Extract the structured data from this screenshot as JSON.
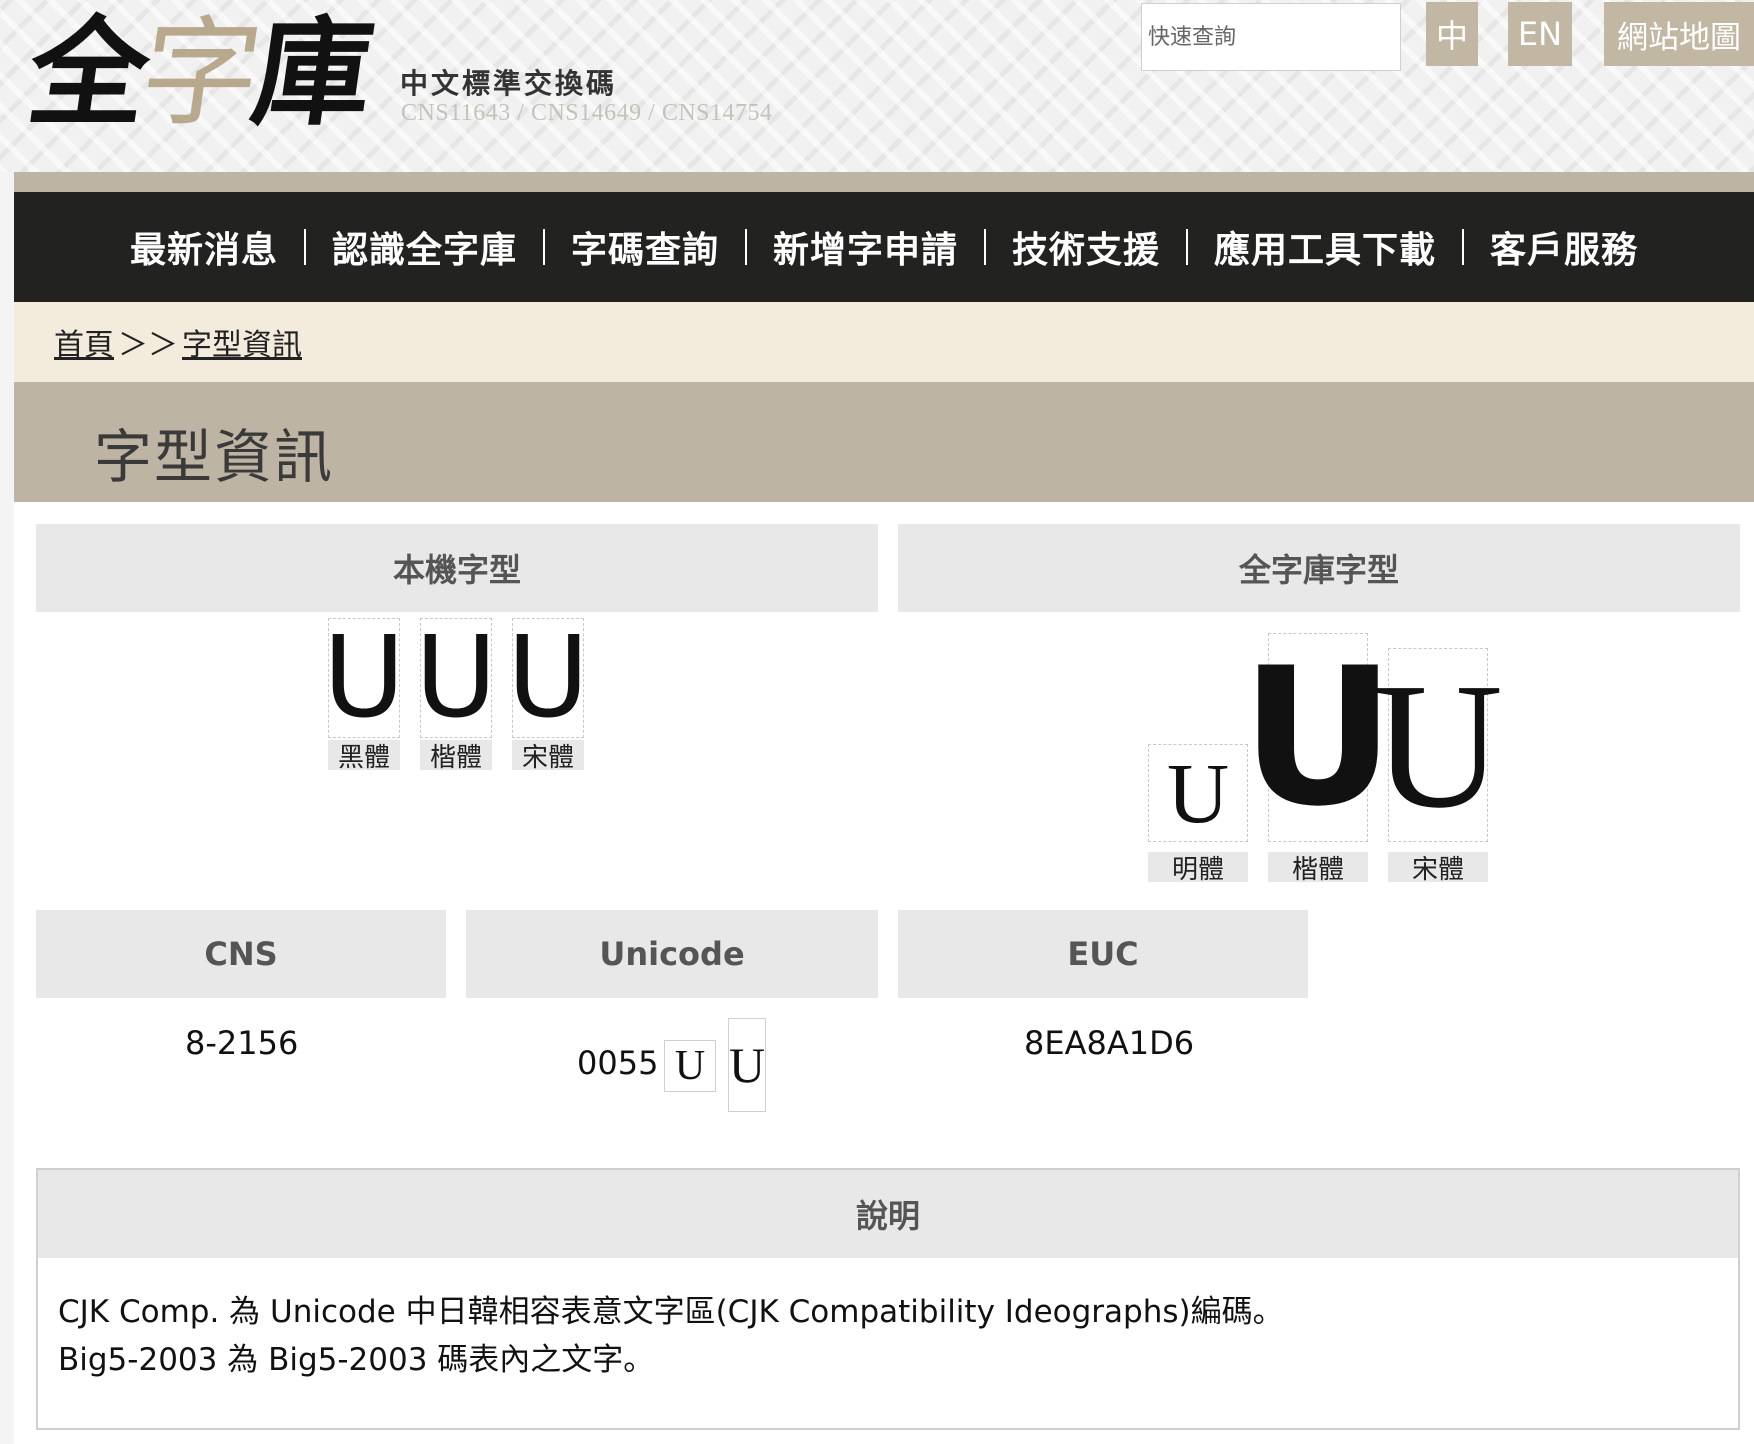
{
  "header": {
    "logo_chars": [
      "全",
      "字",
      "庫"
    ],
    "subtitle": "中文標準交換碼",
    "standards": "CNS11643 / CNS14649 / CNS14754",
    "search": {
      "placeholder": "快速查詢",
      "value": ""
    },
    "buttons": {
      "zh": "中",
      "en": "EN",
      "sitemap": "網站地圖"
    }
  },
  "nav": {
    "items": [
      "最新消息",
      "認識全字庫",
      "字碼查詢",
      "新增字申請",
      "技術支援",
      "應用工具下載",
      "客戶服務"
    ]
  },
  "breadcrumb": {
    "home": "首頁",
    "separator": "＞＞",
    "current": "字型資訊"
  },
  "page": {
    "title": "字型資訊"
  },
  "local_fonts": {
    "header": "本機字型",
    "glyphs": [
      {
        "char": "U",
        "label": "黑體"
      },
      {
        "char": "U",
        "label": "楷體"
      },
      {
        "char": "U",
        "label": "宋體"
      }
    ]
  },
  "qzk_fonts": {
    "header": "全字庫字型",
    "glyphs": [
      {
        "char": "U",
        "label": "明體"
      },
      {
        "char": "U",
        "label": "楷體"
      },
      {
        "char": "U",
        "label": "宋體"
      }
    ]
  },
  "codes": {
    "cns": {
      "header": "CNS",
      "value": "8-2156"
    },
    "unicode": {
      "header": "Unicode",
      "value": "0055",
      "preview_chars": [
        "U",
        "U"
      ]
    },
    "euc": {
      "header": "EUC",
      "value": "8EA8A1D6"
    }
  },
  "description": {
    "header": "說明",
    "lines": [
      "CJK Comp. 為 Unicode 中日韓相容表意文字區(CJK Compatibility Ideographs)編碼。",
      "Big5-2003 為 Big5-2003 碼表內之文字。"
    ]
  },
  "colors": {
    "accent_tan": "#c2b7a2",
    "nav_bg": "#222220",
    "breadcrumb_bg": "#f3ecdd",
    "title_band": "#bdb4a4",
    "panel_header": "#e8e8e8"
  }
}
